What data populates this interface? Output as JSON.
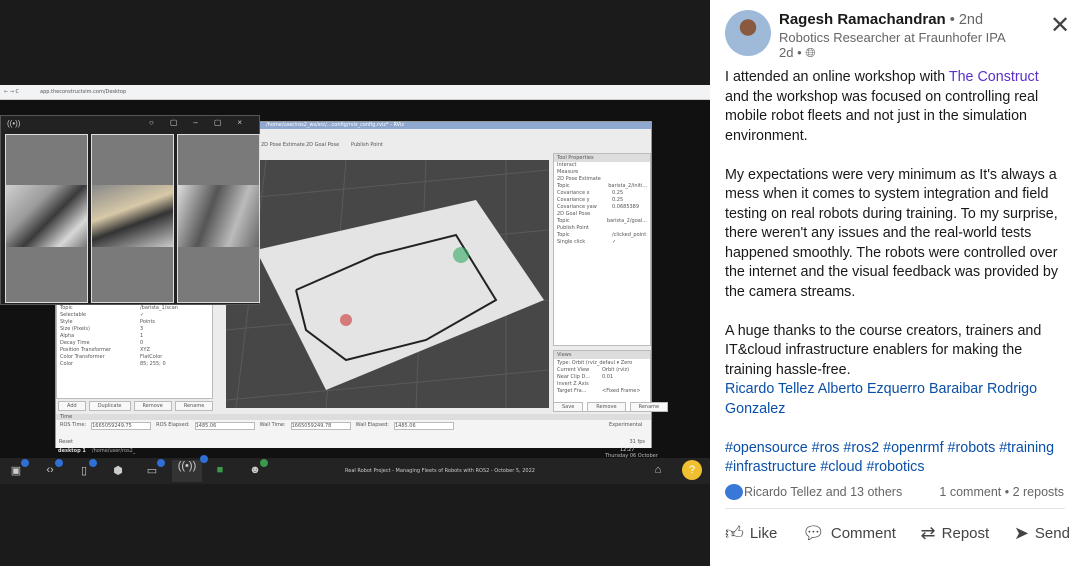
{
  "screenshot": {
    "browser_url": "app.theconstructsim.com/Desktop",
    "rviz_title": "/home/user/ros2_ws/src/...config/rviz_config.rviz* - RViz",
    "toolbar": [
      "2D Pose Estimate",
      "2D Goal Pose",
      "Publish Point"
    ],
    "display_props": [
      [
        "Topic",
        "/barista_1/scan"
      ],
      [
        "Selectable",
        "✓"
      ],
      [
        "Style",
        "Points"
      ],
      [
        "Size (Pixels)",
        "3"
      ],
      [
        "Alpha",
        "1"
      ],
      [
        "Decay Time",
        "0"
      ],
      [
        "Position Transformer",
        "XYZ"
      ],
      [
        "Color Transformer",
        "FlatColor"
      ],
      [
        "Color",
        "85; 255; 0"
      ]
    ],
    "display_buttons": [
      "Add",
      "Duplicate",
      "Remove",
      "Rename"
    ],
    "tool_properties_title": "Tool Properties",
    "tool_props": [
      [
        "Interact",
        ""
      ],
      [
        "Measure",
        ""
      ],
      [
        "2D Pose Estimate",
        ""
      ],
      [
        "Topic",
        "barista_2/initi..."
      ],
      [
        "Covariance x",
        "0.25"
      ],
      [
        "Covariance y",
        "0.25"
      ],
      [
        "Covariance yaw",
        "0.0685389"
      ],
      [
        "2D Goal Pose",
        ""
      ],
      [
        "Topic",
        "barista_2/goal..."
      ],
      [
        "Publish Point",
        ""
      ],
      [
        "Topic",
        "/clicked_point"
      ],
      [
        "Single click",
        "✓"
      ]
    ],
    "views": {
      "title": "Views",
      "type_label": "Type:",
      "type_value": "Orbit (rviz_defaul ▾",
      "zero": "Zero",
      "rows": [
        [
          "Current View",
          "Orbit (rviz)"
        ],
        [
          "Near Clip D...",
          "0.01"
        ],
        [
          "Invert Z Axis",
          ""
        ],
        [
          "Target Fra...",
          "<Fixed Frame>"
        ]
      ],
      "buttons": [
        "Save",
        "Remove",
        "Rename"
      ]
    },
    "time": {
      "title": "Time",
      "ros_time_label": "ROS Time:",
      "ros_time": "1665059249.75",
      "ros_elapsed_label": "ROS Elapsed:",
      "ros_elapsed": "1485.06",
      "wall_time_label": "Wall Time:",
      "wall_time": "1665059249.78",
      "wall_elapsed_label": "Wall Elapsed:",
      "wall_elapsed": "1485.06",
      "experimental": "Experimental",
      "reset": "Reset",
      "fps": "31 fps"
    },
    "desktop_tabs": [
      "desktop 1",
      "/home/user/ros2_"
    ],
    "clock": "12:27",
    "date": "Thursday 06 October",
    "taskbar_title": "Real Robot Project - Managing Fleets of Robots with ROS2 - October 5, 2022",
    "help": "?"
  },
  "post": {
    "author": "Ragesh Ramachandran",
    "degree": "• 2nd",
    "headline": "Robotics Researcher at Fraunhofer IPA",
    "time": "2d •",
    "p1_a": "I attended an online workshop with ",
    "p1_link": "The Construct",
    "p1_b": " and the workshop was focused on controlling real mobile robot fleets and not just in the simulation environment.",
    "p2": "My expectations were very minimum as It's always a mess when it comes to system integration and field testing on real robots during training. To my surprise, there weren't any issues and the real-world tests happened smoothly. The robots were controlled over the internet and the visual feedback was provided by the camera streams.",
    "p3": "A huge thanks to the course creators, trainers and IT&cloud infrastructure enablers for making the training hassle-free.",
    "mentions": "Ricardo Tellez Alberto Ezquerro Baraibar Rodrigo Gonzalez",
    "hashtags": "#opensource #ros #ros2 #openrmf #robots #training #infrastructure #cloud #robotics",
    "reactions": "Ricardo Tellez and 13 others",
    "comments": "1 comment • 2 reposts",
    "actions": [
      "Like",
      "Comment",
      "Repost",
      "Send"
    ]
  }
}
